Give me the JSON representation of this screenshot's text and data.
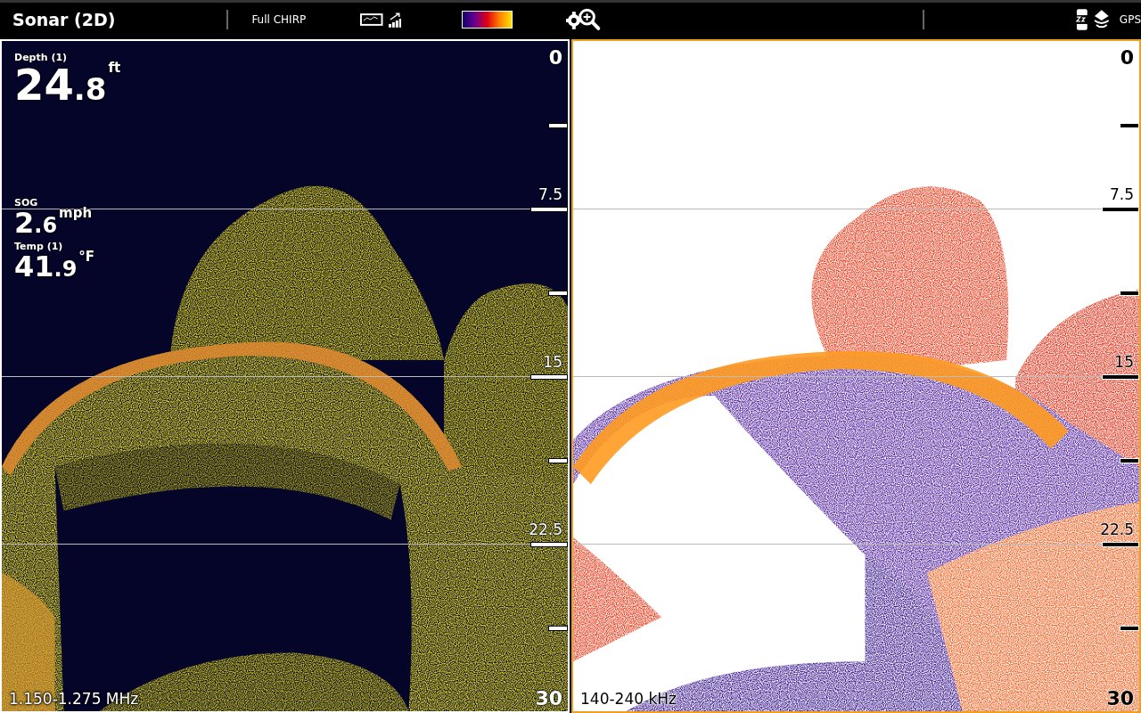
{
  "title": "Sonar (2D)",
  "mode": "Full CHIRP",
  "status": {
    "gps": "GPS"
  },
  "panes": [
    {
      "selected": false,
      "frequency": "1.150-1.275 MHz",
      "scale": [
        "0",
        "7.5",
        "15",
        "22.5",
        "30"
      ],
      "readouts": [
        {
          "label": "Depth (1)",
          "whole": "24",
          "fraction": ".8",
          "unit": "ft"
        },
        {
          "label": "SOG",
          "whole": "2",
          "fraction": ".6",
          "unit": "mph"
        },
        {
          "label": "Temp (1)",
          "whole": "41",
          "fraction": ".9",
          "unit": "°F"
        }
      ]
    },
    {
      "selected": true,
      "frequency": "140-240 kHz",
      "scale": [
        "0",
        "7.5",
        "15",
        "22.5",
        "30"
      ]
    }
  ]
}
